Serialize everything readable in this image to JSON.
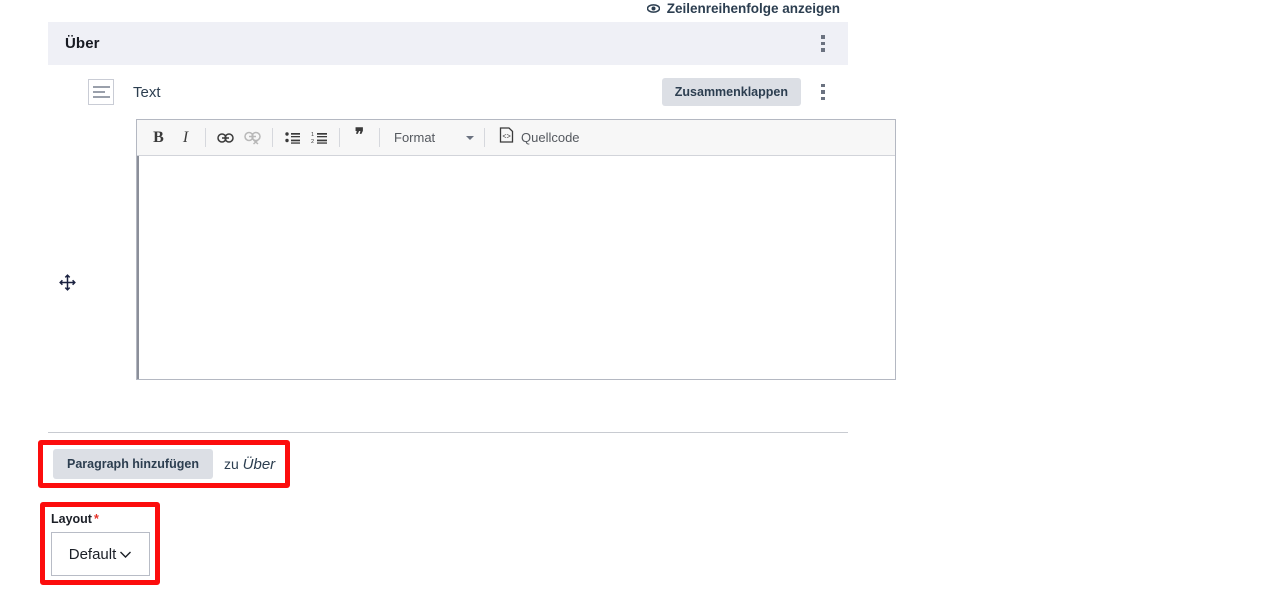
{
  "top_bar": {
    "row_order_link": "Zeilenreihenfolge anzeigen",
    "eye_icon": "eye-icon"
  },
  "about_section": {
    "title": "Über",
    "menu_icon": "kebab-menu-icon",
    "paragraph": {
      "type_icon": "text-lines-icon",
      "type_label": "Text",
      "collapse_label": "Zusammenklappen",
      "menu_icon": "kebab-menu-icon",
      "drag_icon": "move-handle-icon",
      "editor": {
        "toolbar": {
          "bold": "B",
          "italic": "I",
          "link_icon": "link-icon",
          "unlink_icon": "unlink-icon",
          "bulleted_list_icon": "bulleted-list-icon",
          "numbered_list_icon": "numbered-list-icon",
          "blockquote": "❞",
          "format_label": "Format",
          "format_caret": "chevron-down-icon",
          "source_icon": "source-code-icon",
          "source_label": "Quellcode"
        },
        "content": ""
      }
    }
  },
  "add_paragraph": {
    "button_label": "Paragraph hinzufügen",
    "suffix_text": "zu",
    "target_name": "Über",
    "highlight_color": "#fc0d0d"
  },
  "layout_field": {
    "label": "Layout",
    "required_marker": "*",
    "selected_value": "Default",
    "caret_icon": "chevron-down-icon",
    "highlight_color": "#fc0d0d"
  }
}
